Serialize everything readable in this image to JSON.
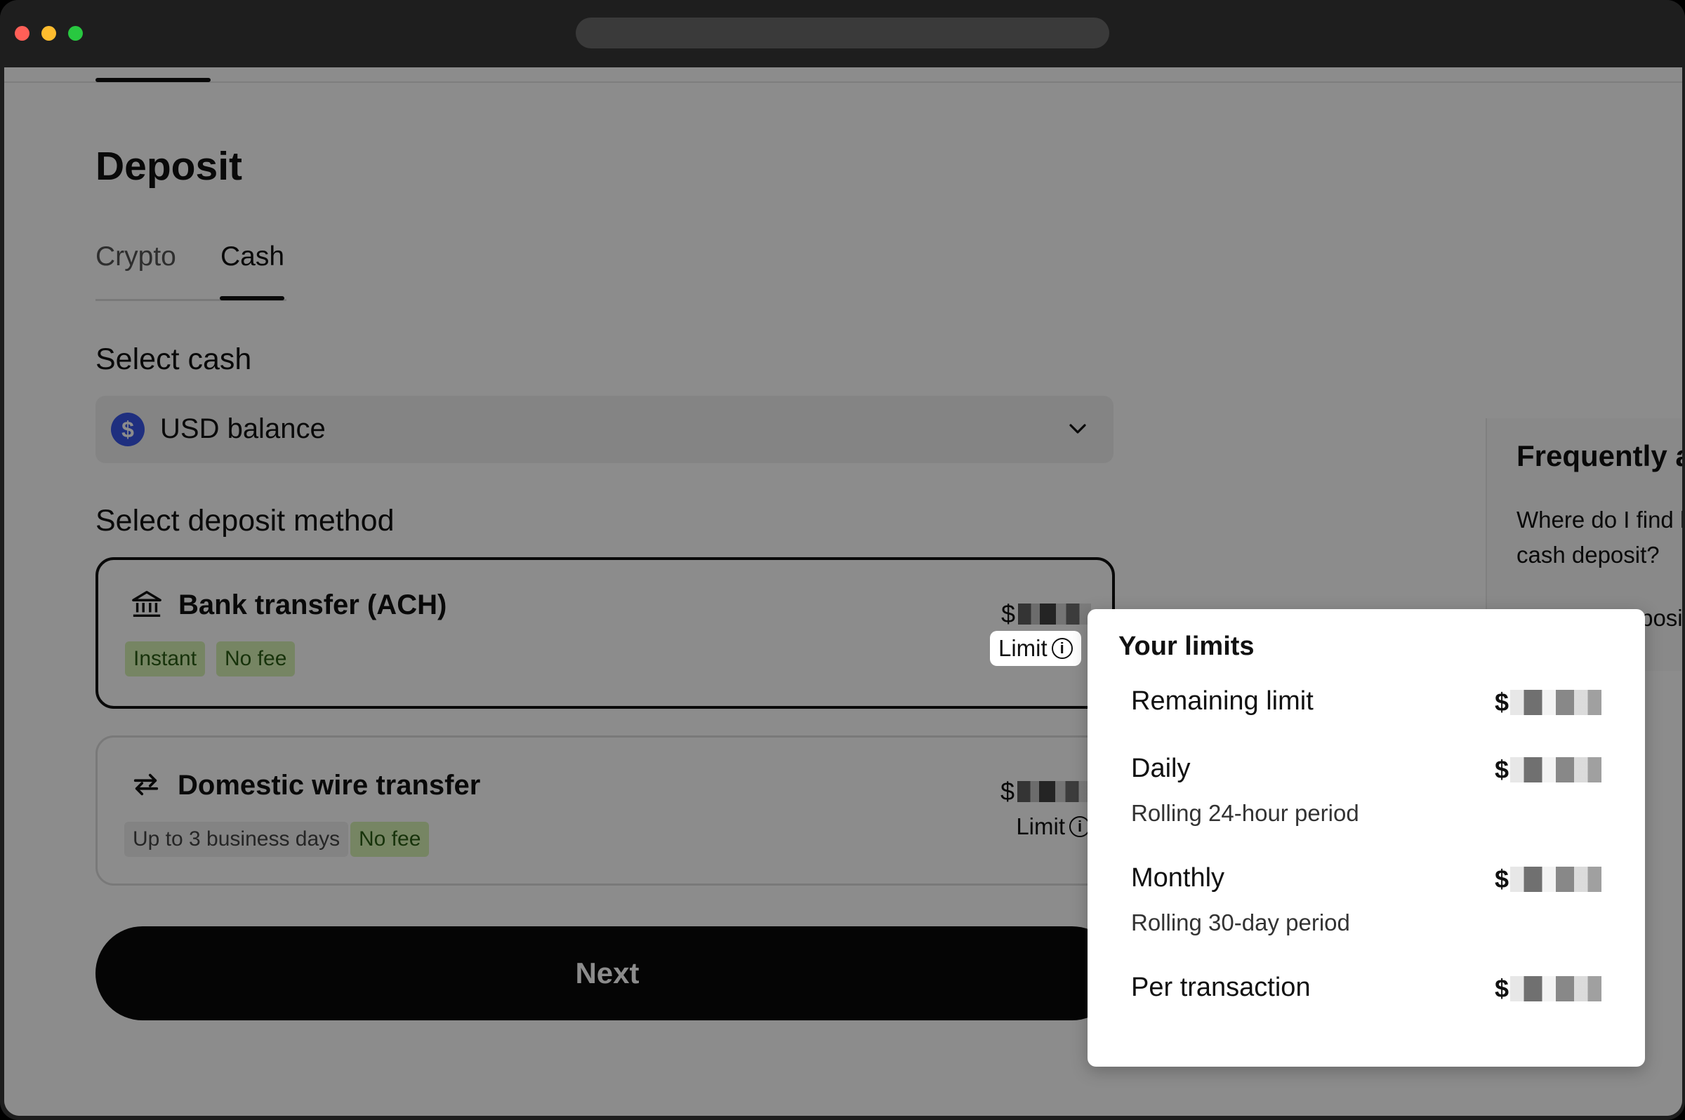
{
  "page": {
    "title": "Deposit",
    "tabs": [
      {
        "label": "Crypto",
        "active": false
      },
      {
        "label": "Cash",
        "active": true
      }
    ]
  },
  "select_cash": {
    "label": "Select cash",
    "value": "USD balance",
    "icon": "dollar-coin-icon",
    "icon_glyph": "$",
    "accent_color": "#3a57e8"
  },
  "deposit_method": {
    "label": "Select deposit method",
    "methods": [
      {
        "title": "Bank transfer (ACH)",
        "icon": "bank-icon",
        "badges": [
          "Instant",
          "No fee"
        ],
        "amount_prefix": "$",
        "limit_label": "Limit",
        "selected": true
      },
      {
        "title": "Domestic wire transfer",
        "icon": "transfer-arrows-icon",
        "badges": [
          "Up to 3 business days",
          "No fee"
        ],
        "amount_prefix": "$",
        "limit_label": "Limit",
        "selected": false
      }
    ]
  },
  "next_button": {
    "label": "Next"
  },
  "faq": {
    "title": "Frequently a",
    "questions": [
      "Where do I find l",
      "cash deposit?",
      "How do I deposi"
    ]
  },
  "limits_popover": {
    "title": "Your limits",
    "rows": [
      {
        "label": "Remaining limit",
        "sub": "",
        "value_prefix": "$"
      },
      {
        "label": "Daily",
        "sub": "Rolling 24-hour period",
        "value_prefix": "$"
      },
      {
        "label": "Monthly",
        "sub": "Rolling 30-day period",
        "value_prefix": "$"
      },
      {
        "label": "Per transaction",
        "sub": "",
        "value_prefix": "$"
      }
    ]
  },
  "colors": {
    "badge_green_bg": "#d8f2b4",
    "badge_gray_bg": "#eeeeee",
    "primary_button": "#0a0a0a"
  }
}
